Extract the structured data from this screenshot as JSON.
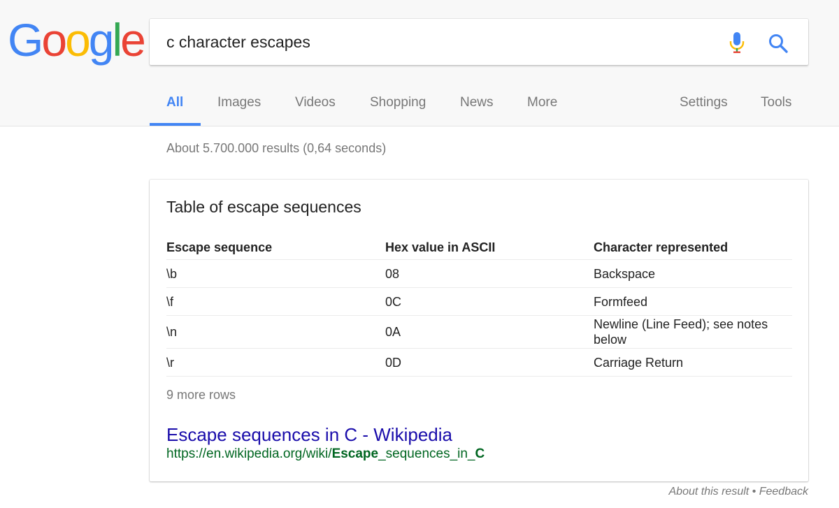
{
  "logo": {
    "letters": [
      "G",
      "o",
      "o",
      "g",
      "l",
      "e"
    ],
    "colors": [
      "#4285f4",
      "#ea4335",
      "#fbbc05",
      "#4285f4",
      "#34a853",
      "#ea4335"
    ]
  },
  "search": {
    "query": "c character escapes",
    "mic_icon": "mic-icon",
    "search_icon": "search-icon"
  },
  "tabs": {
    "items": [
      {
        "label": "All",
        "active": true
      },
      {
        "label": "Images"
      },
      {
        "label": "Videos"
      },
      {
        "label": "Shopping"
      },
      {
        "label": "News"
      },
      {
        "label": "More"
      }
    ],
    "settings": "Settings",
    "tools": "Tools",
    "accent": "#4285f4"
  },
  "result_stats": "About 5.700.000 results (0,64 seconds)",
  "snippet": {
    "title": "Table of escape sequences",
    "headers": [
      "Escape sequence",
      "Hex value in ASCII",
      "Character represented"
    ],
    "rows": [
      [
        "\\b",
        "08",
        "Backspace"
      ],
      [
        "\\f",
        "0C",
        "Formfeed"
      ],
      [
        "\\n",
        "0A",
        "Newline (Line Feed); see notes below"
      ],
      [
        "\\r",
        "0D",
        "Carriage Return"
      ]
    ],
    "more_rows": "9 more rows",
    "result_title": "Escape sequences in C - Wikipedia",
    "url_prefix": "https://en.wikipedia.org/wiki/",
    "url_bold1": "Escape",
    "url_mid": "_sequences_in_",
    "url_bold2": "C",
    "link_color": "#1a0dab",
    "url_color": "#006621"
  },
  "footer": {
    "about": "About this result",
    "separator": " • ",
    "feedback": "Feedback"
  }
}
